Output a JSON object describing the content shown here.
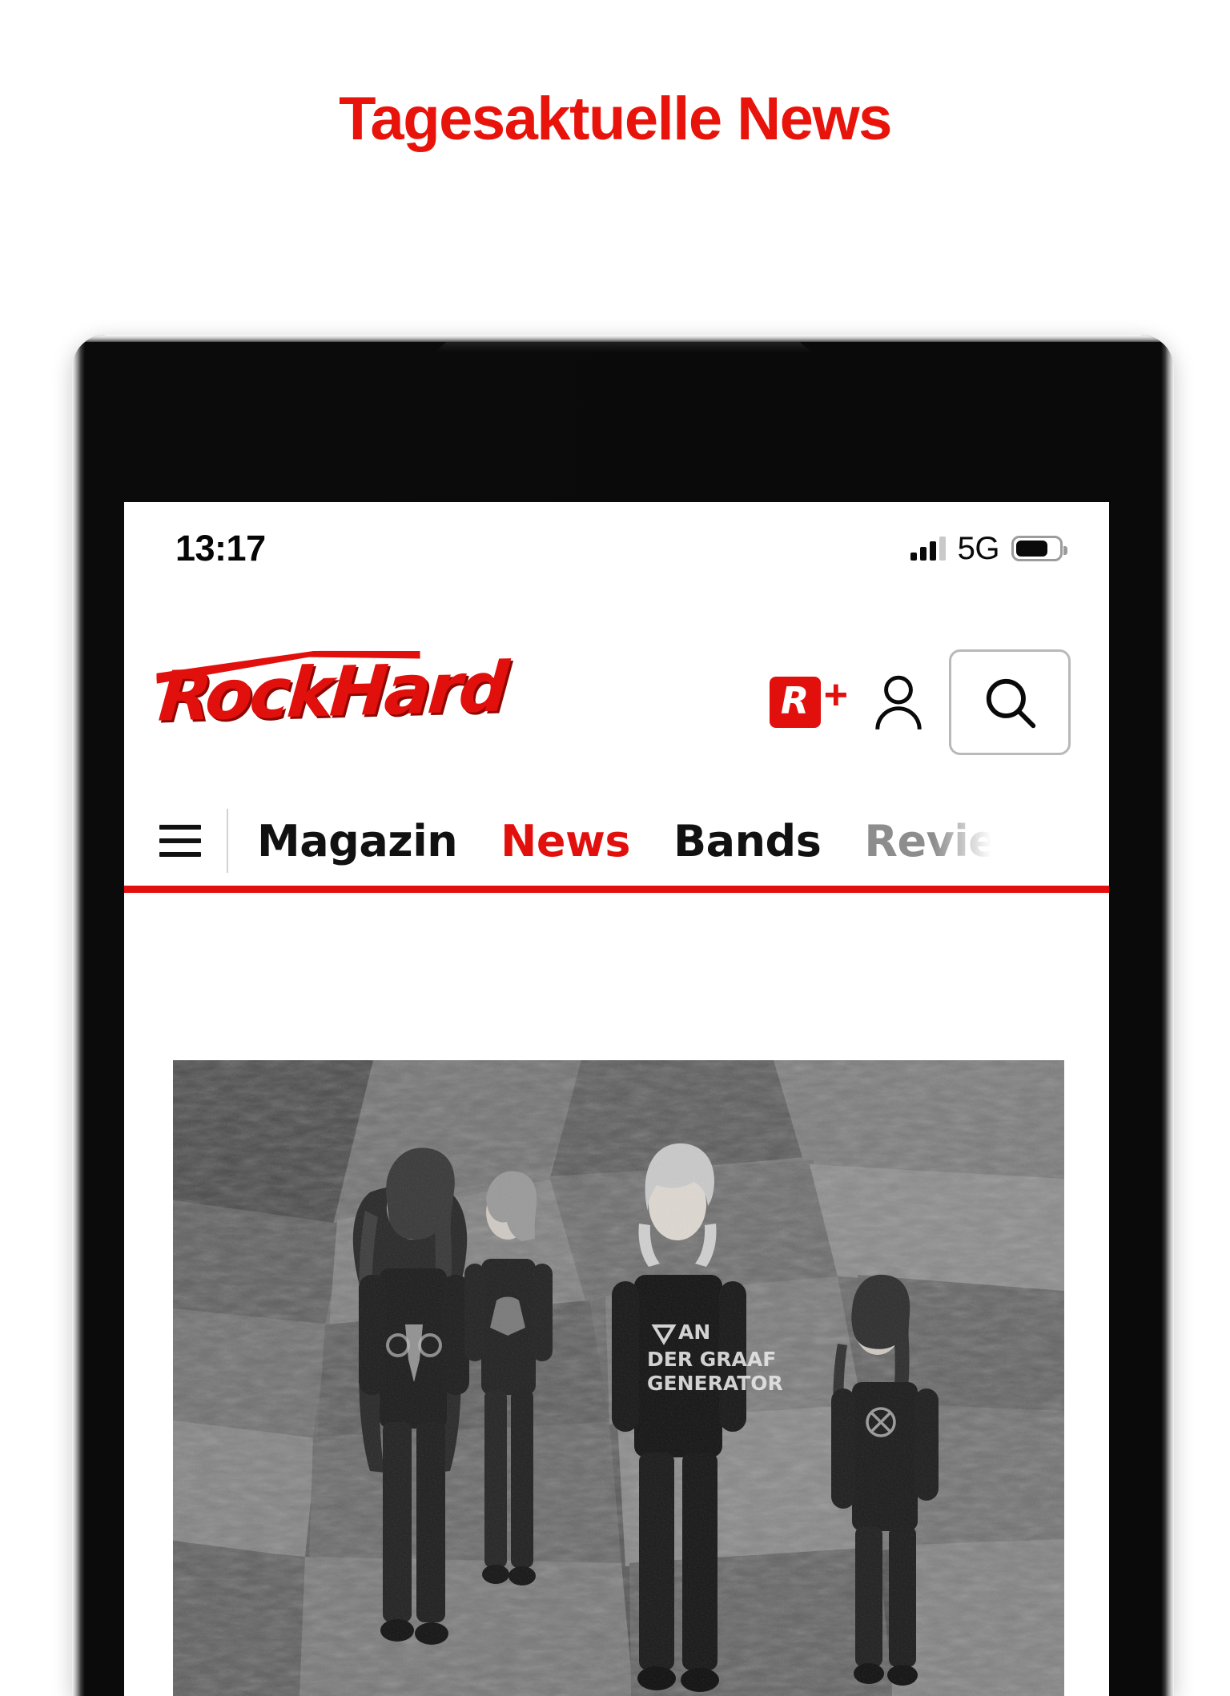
{
  "promo": {
    "headline": "Tagesaktuelle News",
    "headline_color": "#e8140c"
  },
  "device": {
    "type": "tablet",
    "camera_icon": "front-camera"
  },
  "statusbar": {
    "time": "13:17",
    "network_label": "5G",
    "signal_icon": "cellular-signal-icon",
    "signal_bars_filled": 3,
    "signal_bars_total": 4,
    "battery_icon": "battery-icon",
    "battery_percent": 75
  },
  "header": {
    "logo_text": "RockHard",
    "logo_name": "rockhard-logo",
    "rplus": {
      "badge_letter": "R",
      "plus": "+",
      "label": "R+"
    },
    "account_icon": "user-account-icon",
    "search_icon": "search-icon"
  },
  "nav": {
    "menu_icon": "hamburger-menu-icon",
    "items": [
      {
        "label": "Magazin",
        "state": "default"
      },
      {
        "label": "News",
        "state": "active"
      },
      {
        "label": "Bands",
        "state": "default"
      },
      {
        "label": "Revie",
        "state": "cut-off"
      }
    ],
    "underline_color": "#e2100c"
  },
  "content": {
    "article_image": {
      "name": "news-article-photo",
      "description": "Black and white photo of a four-piece band standing on rocky terrain",
      "shirt_text": "VAN DER GRAAF GENERATOR"
    }
  },
  "colors": {
    "brand_red": "#e2100c",
    "headline_red": "#e8140c",
    "text_black": "#111111",
    "muted_gray": "#8d8d8d"
  }
}
